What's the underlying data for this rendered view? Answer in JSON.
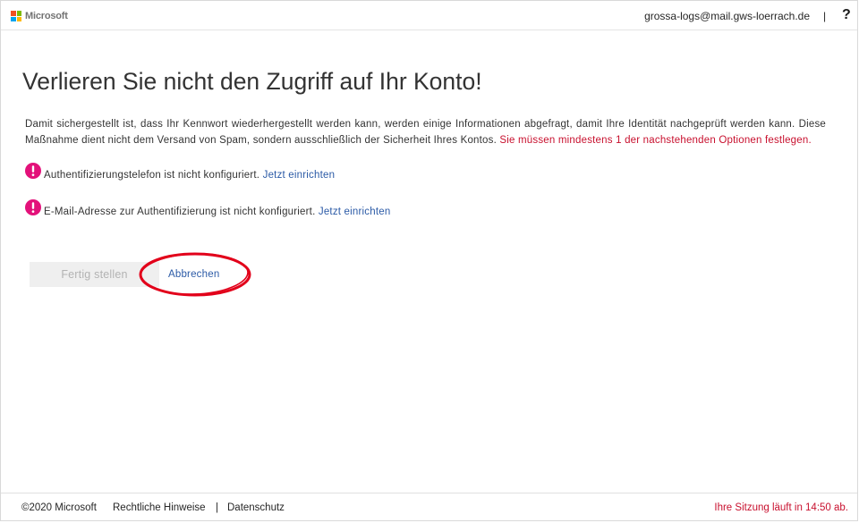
{
  "header": {
    "brand": "Microsoft",
    "logo_icon": "microsoft-logo-icon",
    "user_email": "grossa-logs@mail.gws-loerrach.de",
    "separator": "|",
    "help_label": "?"
  },
  "main": {
    "title": "Verlieren Sie nicht den Zugriff auf Ihr Konto!",
    "intro": "Damit sichergestellt ist, dass Ihr Kennwort wiederhergestellt werden kann, werden einige Informationen abgefragt, damit Ihre Identität nachgeprüft werden kann. Diese Maßnahme dient nicht dem Versand von Spam, sondern ausschließlich der Sicherheit Ihres Kontos.",
    "intro_warning": "Sie müssen mindestens 1 der nachstehenden Optionen festlegen.",
    "items": [
      {
        "icon": "alert-icon",
        "text": "Authentifizierungstelefon ist nicht konfiguriert.",
        "link": "Jetzt einrichten"
      },
      {
        "icon": "alert-icon",
        "text": "E-Mail-Adresse zur Authentifizierung ist nicht konfiguriert.",
        "link": "Jetzt einrichten"
      }
    ],
    "finish_button": {
      "label": "Fertig stellen",
      "disabled": true
    },
    "cancel_link": "Abbrechen"
  },
  "footer": {
    "copyright": "©2020 Microsoft",
    "legal": "Rechtliche Hinweise",
    "separator": "|",
    "privacy": "Datenschutz",
    "session_notice": "Ihre Sitzung läuft in 14:50 ab."
  },
  "colors": {
    "link_blue": "#2b5aa6",
    "warning_red": "#c8102e",
    "alert_pink": "#e3117a",
    "annotation_red": "#e2001a",
    "logo_red": "#f25022",
    "logo_green": "#7fba00",
    "logo_blue": "#00a4ef",
    "logo_yellow": "#ffb900"
  }
}
